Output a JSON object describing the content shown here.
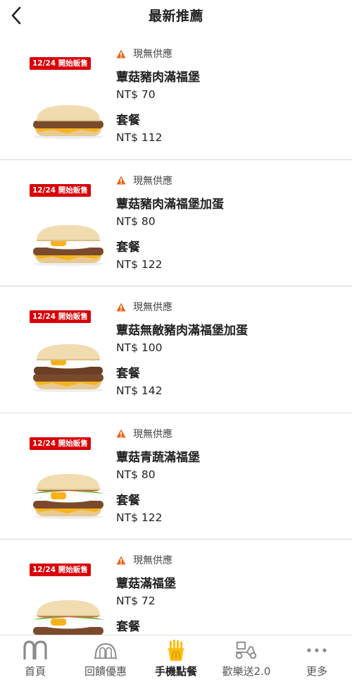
{
  "header": {
    "title": "最新推薦"
  },
  "items": [
    {
      "badge": "12/24 開始販售",
      "status": "現無供應",
      "name": "蕈菇豬肉滿福堡",
      "price": "NT$ 70",
      "set_label": "套餐",
      "set_price": "NT$ 112",
      "egg": false,
      "veg": false,
      "double": false
    },
    {
      "badge": "12/24 開始販售",
      "status": "現無供應",
      "name": "蕈菇豬肉滿福堡加蛋",
      "price": "NT$ 80",
      "set_label": "套餐",
      "set_price": "NT$ 122",
      "egg": true,
      "veg": false,
      "double": false
    },
    {
      "badge": "12/24 開始販售",
      "status": "現無供應",
      "name": "蕈菇無敵豬肉滿福堡加蛋",
      "price": "NT$ 100",
      "set_label": "套餐",
      "set_price": "NT$ 142",
      "egg": true,
      "veg": false,
      "double": true
    },
    {
      "badge": "12/24 開始販售",
      "status": "現無供應",
      "name": "蕈菇青蔬滿福堡",
      "price": "NT$ 80",
      "set_label": "套餐",
      "set_price": "NT$ 122",
      "egg": true,
      "veg": true,
      "double": false
    },
    {
      "badge": "12/24 開始販售",
      "status": "現無供應",
      "name": "蕈菇滿福堡",
      "price": "NT$ 72",
      "set_label": "套餐",
      "set_price": "",
      "egg": true,
      "veg": true,
      "double": false
    }
  ],
  "tabbar": {
    "items": [
      {
        "label": "首頁",
        "icon": "mcdonalds-arches-icon",
        "active": false
      },
      {
        "label": "回饋優惠",
        "icon": "rewards-arch-icon",
        "active": false
      },
      {
        "label": "手機點餐",
        "icon": "fries-icon",
        "active": true
      },
      {
        "label": "歡樂送2.0",
        "icon": "delivery-scooter-icon",
        "active": false
      },
      {
        "label": "更多",
        "icon": "more-dots-icon",
        "active": false
      }
    ]
  },
  "colors": {
    "badge_red": "#d90007",
    "warning_orange": "#e8671c",
    "active_yellow": "#ffbc0d",
    "inactive_gray": "#888888"
  }
}
